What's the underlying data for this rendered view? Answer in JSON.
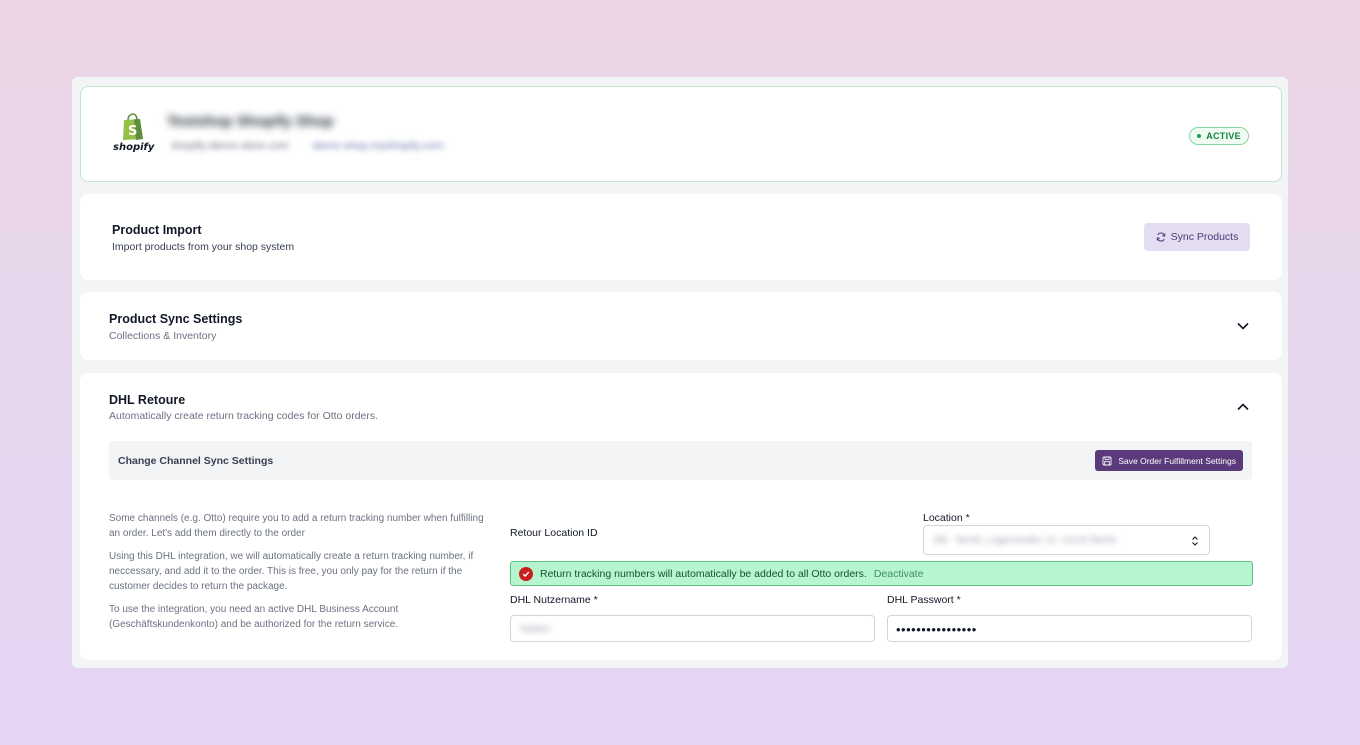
{
  "shop": {
    "name": "Testshop Shopify Shop",
    "meta_1": "shopify-demo-store.com",
    "meta_2": "demo-shop.myshopify.com",
    "logo_text": "shopify",
    "status": "ACTIVE",
    "status_color": "#16a34a"
  },
  "product_import": {
    "title": "Product Import",
    "subtitle": "Import products from your shop system",
    "button_label": "Sync Products",
    "button_icon": "refresh-icon"
  },
  "product_sync": {
    "title": "Product Sync Settings",
    "subtitle": "Collections & Inventory",
    "expanded": false
  },
  "dhl": {
    "title": "DHL Retoure",
    "subtitle": "Automatically create return tracking codes for Otto orders.",
    "expanded": true,
    "channel_bar_label": "Change Channel Sync Settings",
    "save_button": "Save Order Fulfillment Settings",
    "description": [
      "Some channels (e.g. Otto) require you to add a return tracking number when fulfilling an order. Let's add them directly to the order",
      "Using this DHL integration, we will automatically create a return tracking number, if neccessary, and add it to the order. This is free, you only pay for the return if the customer decides to return the package.",
      "To use the integration, you need an active DHL Business Account (Geschäftskundenkonto) and be authorized for the return service."
    ],
    "retour_location_label": "Retour Location ID",
    "location_label": "Location *",
    "location_value": "DE - Berlin, Lagerstraße 12, 10115 Berlin",
    "success_message": "Return tracking numbers will automatically be added to all Otto orders.",
    "deactivate_label": "Deactivate",
    "username_label": "DHL Nutzername *",
    "username_value": "hidden",
    "password_label": "DHL Passwort *",
    "password_value": "••••••••••••••••"
  },
  "colors": {
    "accent": "#5a3a7a",
    "sync_button_bg": "#e4dcf0",
    "success_bg": "#b7f5cf",
    "success_icon": "#c81e1e"
  }
}
